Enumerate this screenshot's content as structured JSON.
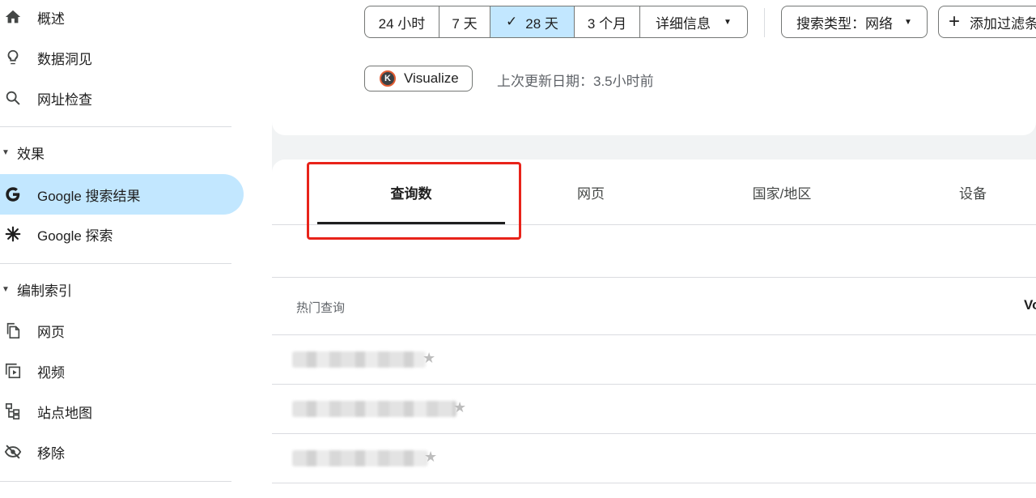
{
  "sidebar": {
    "items": [
      {
        "key": "overview",
        "label": "概述",
        "icon": "home-icon"
      },
      {
        "key": "insights",
        "label": "数据洞见",
        "icon": "lightbulb-icon"
      },
      {
        "key": "url-inspection",
        "label": "网址检查",
        "icon": "search-icon"
      }
    ],
    "performance_section": {
      "label": "效果",
      "items": [
        {
          "key": "google-search",
          "label": "Google 搜索结果",
          "icon": "google-g-icon",
          "active": true
        },
        {
          "key": "google-discover",
          "label": "Google 探索",
          "icon": "discover-asterisk-icon"
        }
      ]
    },
    "indexing_section": {
      "label": "编制索引",
      "items": [
        {
          "key": "pages",
          "label": "网页",
          "icon": "pages-icon"
        },
        {
          "key": "videos",
          "label": "视频",
          "icon": "video-icon"
        },
        {
          "key": "sitemaps",
          "label": "站点地图",
          "icon": "sitemap-icon"
        },
        {
          "key": "removals",
          "label": "移除",
          "icon": "eye-off-icon"
        }
      ]
    }
  },
  "toolbar": {
    "ranges": [
      {
        "label": "24 小时",
        "selected": false
      },
      {
        "label": "7 天",
        "selected": false
      },
      {
        "label": "28 天",
        "selected": true
      },
      {
        "label": "3 个月",
        "selected": false
      }
    ],
    "more_label": "详细信息",
    "search_type_label": "搜索类型：网络",
    "add_filter_label": "添加过滤条",
    "visualize_label": "Visualize",
    "visualize_logo_letter": "K",
    "last_updated": "上次更新日期：3.5小时前"
  },
  "tabs": {
    "items": [
      {
        "label": "查询数",
        "active": true
      },
      {
        "label": "网页",
        "active": false
      },
      {
        "label": "国家/地区",
        "active": false
      },
      {
        "label": "设备",
        "active": false
      }
    ]
  },
  "table": {
    "column_header": "热门查询",
    "right_header_partial": "Vo",
    "rows": [
      {
        "query": "",
        "blurred": true
      },
      {
        "query": "",
        "blurred": true
      },
      {
        "query": "",
        "blurred": true
      }
    ]
  },
  "colors": {
    "active_nav": "#c2e7ff",
    "selected_range": "#c2e7ff",
    "highlight_box": "#e8231a",
    "main_bg": "#f1f3f4"
  }
}
